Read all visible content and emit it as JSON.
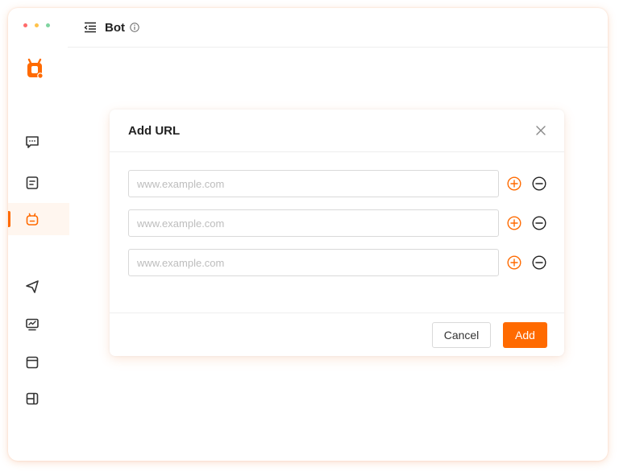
{
  "window": {
    "traffic_lights": [
      "#ff6b6b",
      "#ffc24a",
      "#7fd4a0"
    ]
  },
  "sidebar": {
    "logo": "bot-logo-icon",
    "items": [
      {
        "id": "chat",
        "icon": "chat-bubble-icon",
        "active": false
      },
      {
        "id": "document",
        "icon": "document-icon",
        "active": false
      },
      {
        "id": "bot",
        "icon": "bot-icon",
        "active": true
      },
      {
        "id": "send",
        "icon": "send-icon",
        "active": false
      },
      {
        "id": "monitor",
        "icon": "monitor-icon",
        "active": false
      },
      {
        "id": "browser",
        "icon": "browser-window-icon",
        "active": false
      },
      {
        "id": "layout",
        "icon": "layout-panel-icon",
        "active": false
      }
    ]
  },
  "header": {
    "title": "Bot",
    "menu_icon": "menu-collapse-icon",
    "info_icon": "info-icon"
  },
  "dialog": {
    "title": "Add URL",
    "close_icon": "close-icon",
    "rows": [
      {
        "placeholder": "www.example.com",
        "value": ""
      },
      {
        "placeholder": "www.example.com",
        "value": ""
      },
      {
        "placeholder": "www.example.com",
        "value": ""
      }
    ],
    "cancel_label": "Cancel",
    "add_label": "Add"
  },
  "colors": {
    "accent": "#ff6a00",
    "active_bg": "#fff6ef",
    "icon_gray": "#333333"
  }
}
